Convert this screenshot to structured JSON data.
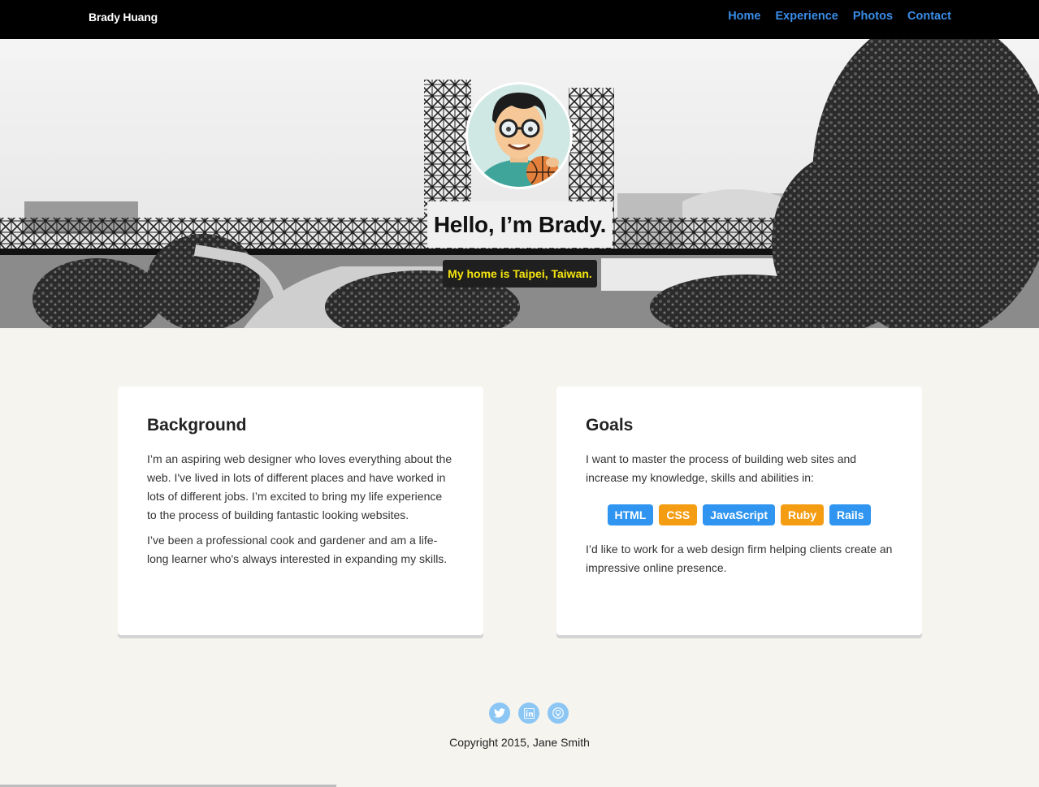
{
  "nav": {
    "brand": "Brady Huang",
    "links": [
      {
        "label": "Home"
      },
      {
        "label": "Experience"
      },
      {
        "label": "Photos"
      },
      {
        "label": "Contact"
      }
    ]
  },
  "hero": {
    "title": "Hello, I’m Brady.",
    "subtitle": "My home is Taipei, Taiwan."
  },
  "background_card": {
    "heading": "Background",
    "paragraphs": [
      "I’m an aspiring web designer who loves everything about the web. I've lived in lots of different places and have worked in lots of different jobs. I’m excited to bring my life experience to the process of building fantastic looking websites.",
      "I’ve been a professional cook and gardener and am a life-long learner who's always interested in expanding my skills."
    ]
  },
  "goals_card": {
    "heading": "Goals",
    "intro": "I want to master the process of building web sites and increase my knowledge, skills and abilities in:",
    "skills": [
      {
        "label": "HTML",
        "color": "#2f95f0"
      },
      {
        "label": "CSS",
        "color": "#f59d12"
      },
      {
        "label": "JavaScript",
        "color": "#2f95f0"
      },
      {
        "label": "Ruby",
        "color": "#f59d12"
      },
      {
        "label": "Rails",
        "color": "#2f95f0"
      }
    ],
    "outro": "I’d like to work for a web design firm helping clients create an impressive online presence."
  },
  "footer": {
    "social": [
      {
        "icon": "twitter-icon"
      },
      {
        "icon": "linkedin-icon"
      },
      {
        "icon": "github-icon"
      }
    ],
    "copyright": "Copyright 2015, Jane Smith"
  },
  "colors": {
    "nav_link": "#3a8de8",
    "subtitle_text": "#f5e60e",
    "page_bg": "#f5f4ef"
  }
}
